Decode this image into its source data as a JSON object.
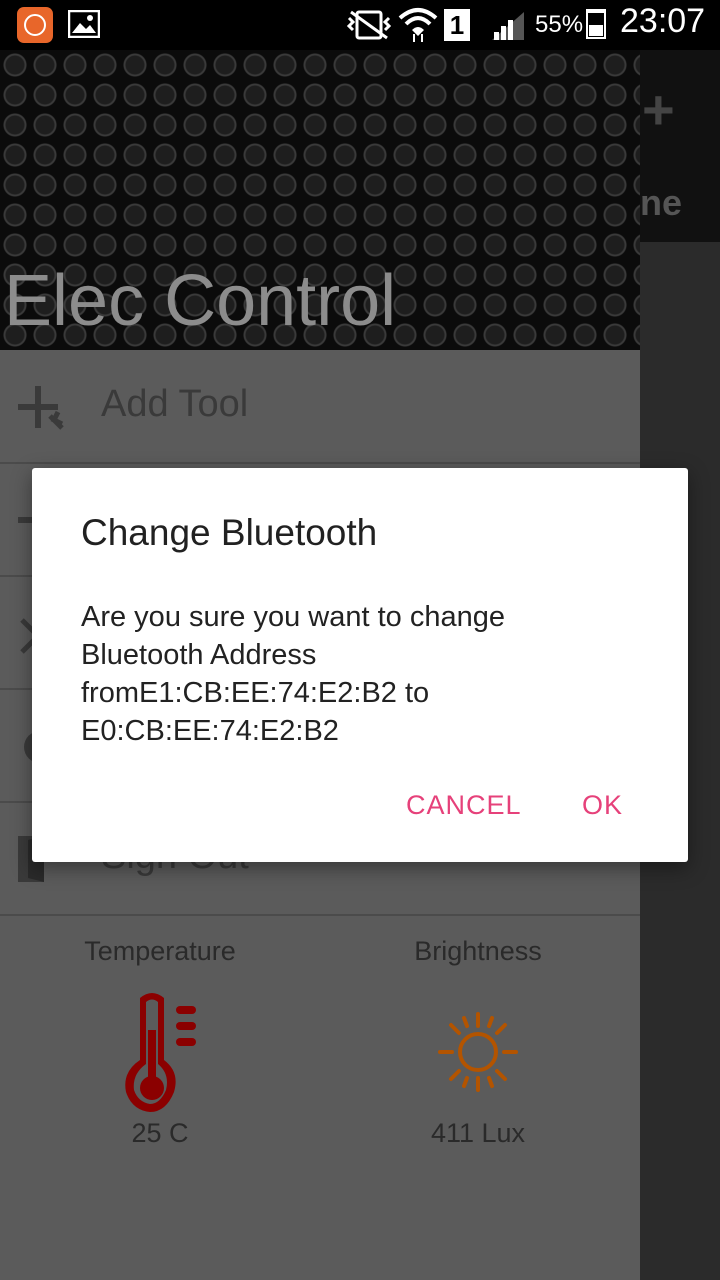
{
  "status_bar": {
    "battery_percent": "55%",
    "sim_slot": "1",
    "time": "23:07",
    "icons": [
      "mi-notification-icon",
      "gallery-icon",
      "vibrate-icon",
      "wifi-icon",
      "sim-icon",
      "signal-icon",
      "battery-icon"
    ]
  },
  "drawer": {
    "app_title": "Elec Control",
    "menu_items": [
      {
        "label": "Add Tool",
        "icon": "add-tool-icon"
      },
      {
        "label": "",
        "icon": "remove-tool-icon"
      },
      {
        "label": "",
        "icon": "close-icon"
      },
      {
        "label": "",
        "icon": "settings-icon"
      },
      {
        "label": "Sign Out",
        "icon": "sign-out-icon"
      }
    ],
    "sensors": {
      "temperature": {
        "title": "Temperature",
        "value": "25 C",
        "color": "#8b0000"
      },
      "brightness": {
        "title": "Brightness",
        "value": "411 Lux",
        "color": "#b35400"
      }
    }
  },
  "background_app": {
    "header_text_fragment": "ne"
  },
  "dialog": {
    "title": "Change Bluetooth",
    "message": "Are you sure you want to change\nBluetooth Address\nfromE1:CB:EE:74:E2:B2 to\nE0:CB:EE:74:E2:B2",
    "cancel_label": "CANCEL",
    "ok_label": "OK",
    "accent_color": "#e6417a"
  }
}
